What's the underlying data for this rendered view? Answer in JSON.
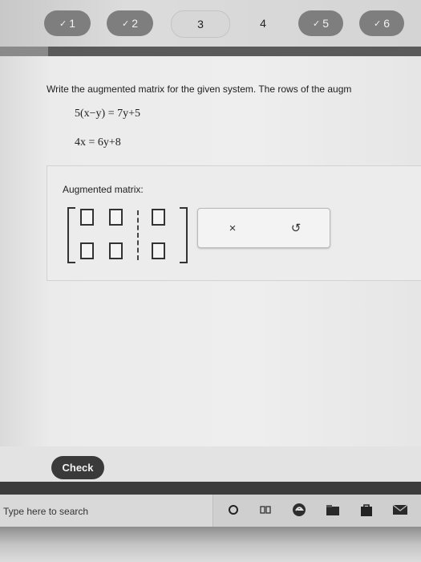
{
  "question_nav": {
    "items": [
      {
        "label": "1",
        "status": "done",
        "check": "✓"
      },
      {
        "label": "2",
        "status": "done",
        "check": "✓"
      },
      {
        "label": "3",
        "status": "current",
        "check": ""
      },
      {
        "label": "4",
        "status": "plain",
        "check": ""
      },
      {
        "label": "5",
        "status": "done",
        "check": "✓"
      },
      {
        "label": "6",
        "status": "done",
        "check": "✓"
      }
    ]
  },
  "question": {
    "prompt": "Write the augmented matrix for the given system. The rows of the augm",
    "equations": [
      "5(x−y) = 7y+5",
      "4x = 6y+8"
    ]
  },
  "answer": {
    "label": "Augmented matrix:",
    "clear_symbol": "×",
    "undo_symbol": "↺"
  },
  "check_button": {
    "label": "Check"
  },
  "taskbar": {
    "search_placeholder": "Type here to search",
    "icons": [
      "cortana-circle-icon",
      "task-view-icon",
      "edge-icon",
      "file-explorer-icon",
      "store-icon",
      "mail-icon"
    ]
  }
}
